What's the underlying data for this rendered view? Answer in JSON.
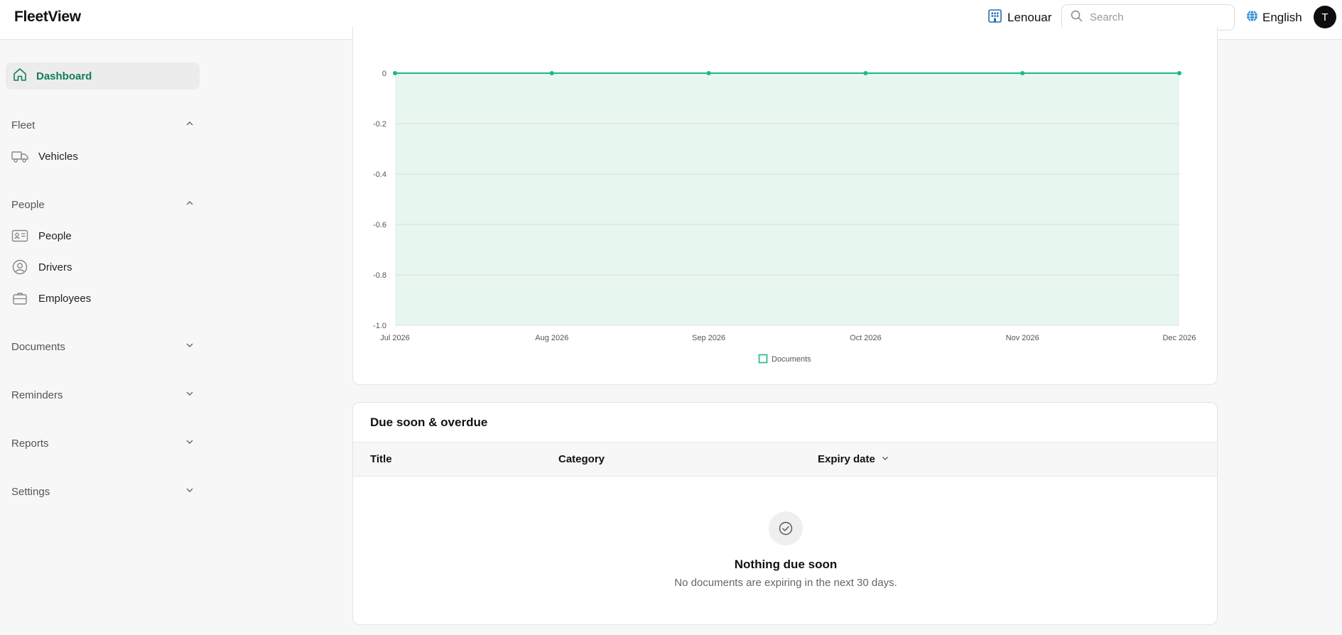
{
  "header": {
    "logo": "FleetView",
    "org_name": "Lenouar",
    "search_placeholder": "Search",
    "language": "English",
    "avatar_initial": "T"
  },
  "sidebar": {
    "dashboard": "Dashboard",
    "groups": {
      "fleet": "Fleet",
      "people": "People",
      "documents": "Documents",
      "reminders": "Reminders",
      "reports": "Reports",
      "settings": "Settings"
    },
    "items": {
      "vehicles": "Vehicles",
      "people": "People",
      "drivers": "Drivers",
      "employees": "Employees"
    }
  },
  "colors": {
    "accent": "#1db980",
    "active_text": "#137d54",
    "area_fill": "#e7f6ef"
  },
  "chart_data": {
    "type": "area",
    "x": [
      "Jul 2026",
      "Aug 2026",
      "Sep 2026",
      "Oct 2026",
      "Nov 2026",
      "Dec 2026"
    ],
    "series": [
      {
        "name": "Documents",
        "values": [
          0,
          0,
          0,
          0,
          0,
          0
        ]
      }
    ],
    "yticks": [
      "0",
      "-0.2",
      "-0.4",
      "-0.6",
      "-0.8",
      "-1.0"
    ],
    "ylim": [
      -1.0,
      0
    ],
    "grid": true,
    "legend": "bottom"
  },
  "due_table": {
    "title": "Due soon & overdue",
    "columns": [
      "Title",
      "Category",
      "Expiry date"
    ],
    "empty_title": "Nothing due soon",
    "empty_desc": "No documents are expiring in the next 30 days."
  }
}
